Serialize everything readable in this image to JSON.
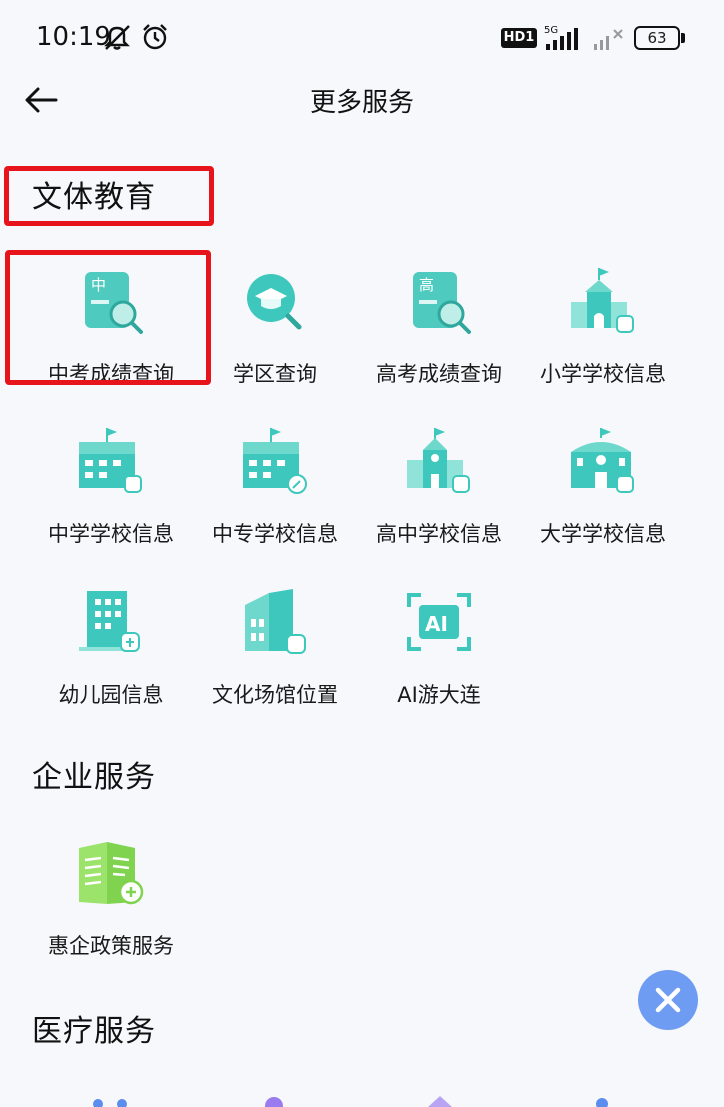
{
  "status_bar": {
    "time": "10:19",
    "hd_badge": "HD1",
    "network": "5G",
    "battery": "63"
  },
  "header": {
    "title": "更多服务"
  },
  "sections": {
    "education": {
      "title": "文体教育",
      "items": [
        {
          "label": "中考成绩查询",
          "icon_text": "中"
        },
        {
          "label": "学区查询"
        },
        {
          "label": "高考成绩查询",
          "icon_text": "高"
        },
        {
          "label": "小学学校信息"
        },
        {
          "label": "中学学校信息"
        },
        {
          "label": "中专学校信息"
        },
        {
          "label": "高中学校信息"
        },
        {
          "label": "大学学校信息"
        },
        {
          "label": "幼儿园信息"
        },
        {
          "label": "文化场馆位置"
        },
        {
          "label": "AI游大连",
          "icon_text": "AI"
        }
      ]
    },
    "business": {
      "title": "企业服务",
      "items": [
        {
          "label": "惠企政策服务"
        }
      ]
    },
    "medical": {
      "title": "医疗服务"
    }
  },
  "colors": {
    "teal": "#3cc7be",
    "teal_light": "#8fe3d9",
    "green": "#7fd34e",
    "highlight_red": "#e8141b",
    "fab_blue": "#6f9cf3"
  }
}
